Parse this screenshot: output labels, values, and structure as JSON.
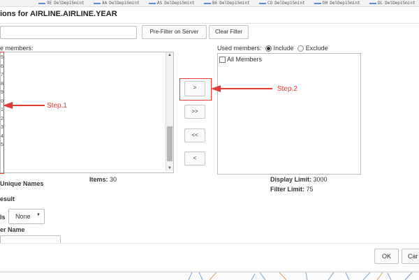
{
  "legend_strip": {
    "items": [
      "9E",
      "AA",
      "AS",
      "B6",
      "CO",
      "DH",
      "DL"
    ],
    "suffix": "DelDep15mint",
    "color": "#5b8bd0"
  },
  "dialog": {
    "title": "ions for AIRLINE.AIRLINE.YEAR",
    "search_value": "",
    "prefilter_label": "Pre-Filter on Server",
    "clear_filter_label": "Clear Filter",
    "available_label": "e members:",
    "available_row_fragments": [
      "5",
      "6",
      "7",
      "8",
      "9",
      "0",
      "1",
      "2",
      "3",
      "4",
      "5"
    ],
    "used_members_label": "Used members:",
    "include_label": "Include",
    "exclude_label": "Exclude",
    "include_selected": true,
    "all_members_label": "All Members",
    "btn_add": ">",
    "btn_add_all": ">>",
    "btn_remove_all": "<<",
    "btn_remove": "<",
    "step1_label": "Step.1",
    "step2_label": "Step.2",
    "unique_names_label": "Unique Names",
    "items_label": "Items:",
    "items_count": "30",
    "display_limit_label": "Display Limit:",
    "display_limit_value": "3000",
    "filter_limit_label": "Filter Limit:",
    "filter_limit_value": "75",
    "result_label": "esult",
    "levels_fragment": "ls",
    "levels_select": "None",
    "member_name_label": "er Name",
    "ok_label": "OK",
    "cancel_label": "Car",
    "accent_color": "#e53935"
  }
}
